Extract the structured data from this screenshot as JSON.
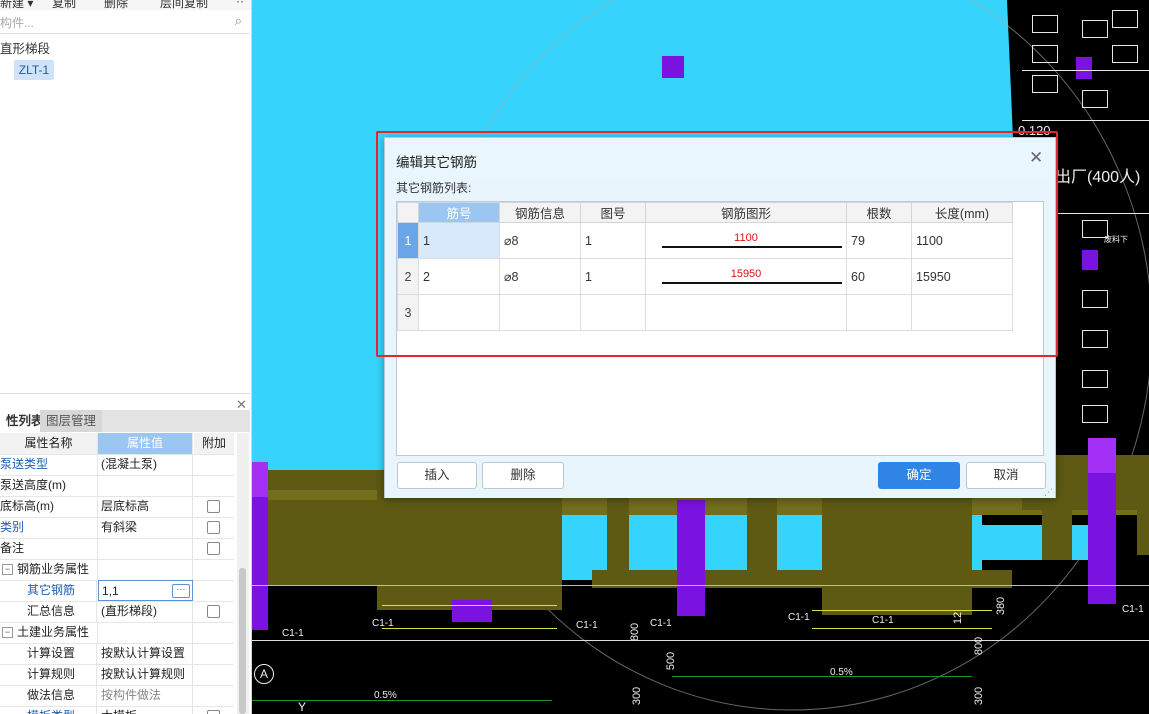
{
  "toolbar": {
    "new": "新建 ▾",
    "copy": "复制",
    "delete": "删除",
    "floor_copy": "层间复制",
    "more": "··"
  },
  "search": {
    "placeholder": "构件...",
    "icon": "search-icon"
  },
  "tree": {
    "group": "直形梯段",
    "item": "ZLT-1"
  },
  "panel_tabs": {
    "properties": "性列表",
    "layers": "图层管理"
  },
  "props": {
    "header": {
      "name": "属性名称",
      "value": "属性值",
      "extra": "附加"
    },
    "rows": [
      {
        "name": "泵送类型",
        "value": "(混凝土泵)"
      },
      {
        "name": "泵送高度(m)",
        "value": ""
      },
      {
        "name": "底标高(m)",
        "value": "层底标高"
      },
      {
        "name": "类别",
        "value": "有斜梁"
      },
      {
        "name": "备注",
        "value": ""
      },
      {
        "name": "钢筋业务属性",
        "value": ""
      },
      {
        "name": "其它钢筋",
        "value": "1,1"
      },
      {
        "name": "汇总信息",
        "value": "(直形梯段)"
      },
      {
        "name": "土建业务属性",
        "value": ""
      },
      {
        "name": "计算设置",
        "value": "按默认计算设置"
      },
      {
        "name": "计算规则",
        "value": "按默认计算规则"
      },
      {
        "name": "做法信息",
        "value": "按构件做法"
      },
      {
        "name": "模板类型",
        "value": "木模板"
      }
    ],
    "edit_dots": "···"
  },
  "dialog": {
    "title": "编辑其它钢筋",
    "list_label": "其它钢筋列表:",
    "columns": [
      "筋号",
      "钢筋信息",
      "图号",
      "钢筋图形",
      "根数",
      "长度(mm)"
    ],
    "rows": [
      {
        "idx": "1",
        "no": "1",
        "info": "⌀8",
        "fig": "1",
        "shape": "1100",
        "count": "79",
        "length": "1100"
      },
      {
        "idx": "2",
        "no": "2",
        "info": "⌀8",
        "fig": "1",
        "shape": "15950",
        "count": "60",
        "length": "15950"
      },
      {
        "idx": "3",
        "no": "",
        "info": "",
        "fig": "",
        "shape": "",
        "count": "",
        "length": ""
      }
    ],
    "buttons": {
      "insert": "插入",
      "delete": "删除",
      "ok": "确定",
      "cancel": "取消"
    }
  },
  "view_labels": {
    "elev": "0.120",
    "room": "出厂(400人)",
    "c1": "C1-1",
    "d800": "800",
    "d500": "500",
    "d300": "300",
    "d380": "380",
    "slope": "0.5%",
    "axis_a": "A",
    "axis_y": "Y",
    "n12": "12",
    "small": "废料下"
  }
}
